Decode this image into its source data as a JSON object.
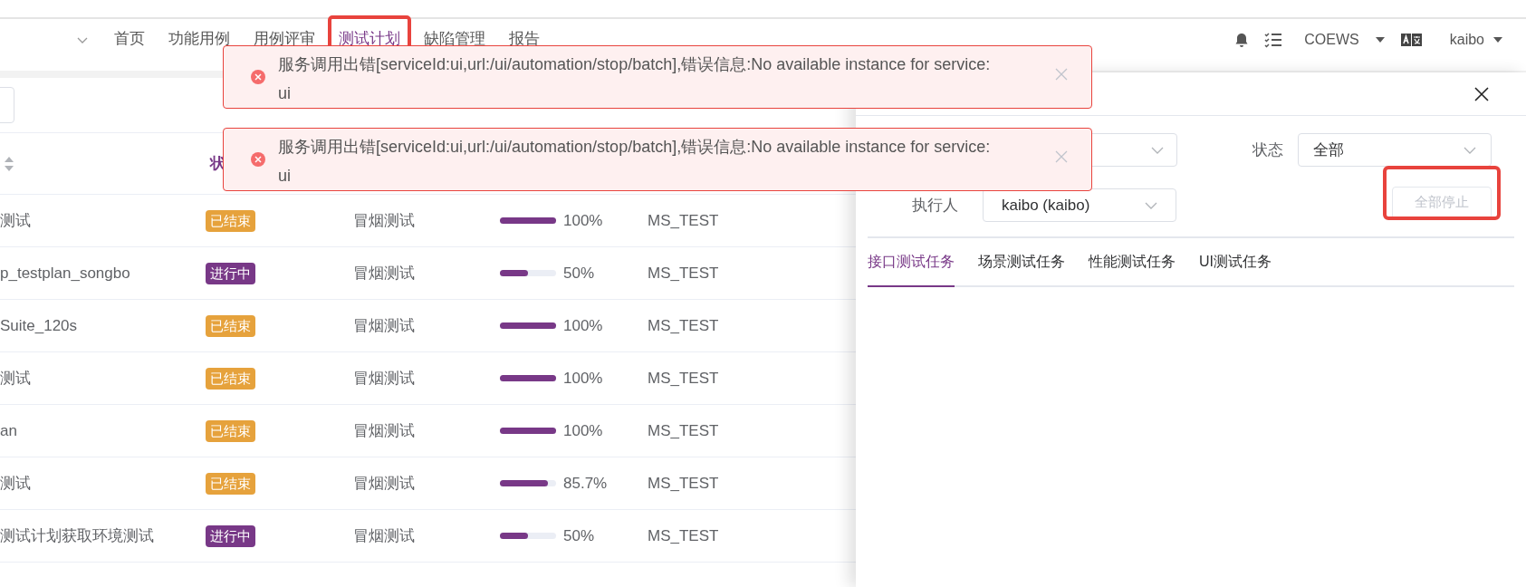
{
  "nav": {
    "items": [
      {
        "label": "首页",
        "selected": false,
        "highlighted": false
      },
      {
        "label": "功能用例",
        "selected": false,
        "highlighted": false
      },
      {
        "label": "用例评审",
        "selected": false,
        "highlighted": false
      },
      {
        "label": "测试计划",
        "selected": true,
        "highlighted": true
      },
      {
        "label": "缺陷管理",
        "selected": false,
        "highlighted": false
      },
      {
        "label": "报告",
        "selected": false,
        "highlighted": false
      }
    ],
    "workspace": "COEWS",
    "user": "kaibo"
  },
  "table": {
    "header": "状",
    "rows": [
      {
        "name": "测试",
        "status": "已结束",
        "kind": "ended",
        "type": "冒烟测试",
        "level": 1,
        "progress": "100%",
        "owner": "MS_TEST"
      },
      {
        "name": "p_testplan_songbo",
        "status": "进行中",
        "kind": "running",
        "type": "冒烟测试",
        "level": 0.5,
        "progress": "50%",
        "owner": "MS_TEST"
      },
      {
        "name": "Suite_120s",
        "status": "已结束",
        "kind": "ended",
        "type": "冒烟测试",
        "level": 1,
        "progress": "100%",
        "owner": "MS_TEST"
      },
      {
        "name": "测试",
        "status": "已结束",
        "kind": "ended",
        "type": "冒烟测试",
        "level": 1,
        "progress": "100%",
        "owner": "MS_TEST"
      },
      {
        "name": "an",
        "status": "已结束",
        "kind": "ended",
        "type": "冒烟测试",
        "level": 1,
        "progress": "100%",
        "owner": "MS_TEST"
      },
      {
        "name": "测试",
        "status": "已结束",
        "kind": "ended",
        "type": "冒烟测试",
        "level": 0.857,
        "progress": "85.7%",
        "owner": "MS_TEST"
      },
      {
        "name": "测试计划获取环境测试",
        "status": "进行中",
        "kind": "running",
        "type": "冒烟测试",
        "level": 0.5,
        "progress": "50%",
        "owner": "MS_TEST"
      }
    ]
  },
  "toasts": [
    {
      "message": "服务调用出错[serviceId:ui,url:/ui/automation/stop/batch],错误信息:No available instance for service:",
      "message_2": "ui"
    },
    {
      "message": "服务调用出错[serviceId:ui,url:/ui/automation/stop/batch],错误信息:No available instance for service:",
      "message_2": "ui"
    }
  ],
  "drawer": {
    "status_label": "状态",
    "status_value": "全部",
    "executor_label": "执行人",
    "executor_value": "kaibo (kaibo)",
    "stop_button": {
      "label": "全部停止",
      "disabled": true,
      "highlighted": true
    },
    "tabs": [
      {
        "label": "接口测试任务",
        "selected": true
      },
      {
        "label": "场景测试任务",
        "selected": false
      },
      {
        "label": "性能测试任务",
        "selected": false
      },
      {
        "label": "UI测试任务",
        "selected": false
      }
    ]
  }
}
